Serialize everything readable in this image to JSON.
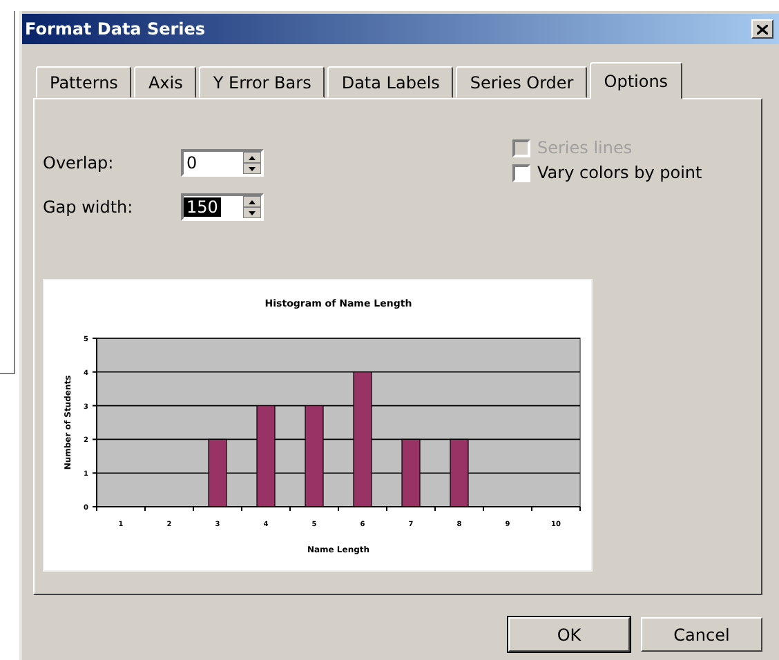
{
  "window": {
    "title": "Format Data Series"
  },
  "tabs": [
    {
      "label": "Patterns",
      "selected": false
    },
    {
      "label": "Axis",
      "selected": false
    },
    {
      "label": "Y Error Bars",
      "selected": false
    },
    {
      "label": "Data Labels",
      "selected": false
    },
    {
      "label": "Series Order",
      "selected": false
    },
    {
      "label": "Options",
      "selected": true
    }
  ],
  "fields": [
    {
      "label": "Overlap:",
      "value": "0",
      "highlighted": false
    },
    {
      "label": "Gap width:",
      "value": "150",
      "highlighted": true
    }
  ],
  "checkboxes": [
    {
      "label": "Series lines",
      "checked": false,
      "disabled": true
    },
    {
      "label": "Vary colors by point",
      "checked": false,
      "disabled": false
    }
  ],
  "preview": {
    "chart_data": {
      "type": "bar",
      "title": "Histogram of Name Length",
      "xlabel": "Name Length",
      "ylabel": "Number of Students",
      "categories": [
        "1",
        "2",
        "3",
        "4",
        "5",
        "6",
        "7",
        "8",
        "9",
        "10"
      ],
      "series": [
        {
          "color": "#993366",
          "values": [
            0,
            0,
            2,
            3,
            3,
            4,
            2,
            2,
            0,
            0
          ]
        }
      ],
      "ylim": [
        0,
        5
      ],
      "yticks": [
        0,
        1,
        2,
        3,
        4,
        5
      ],
      "grid": true
    }
  },
  "buttons": [
    {
      "label": "OK",
      "default": true
    },
    {
      "label": "Cancel",
      "default": false
    }
  ]
}
